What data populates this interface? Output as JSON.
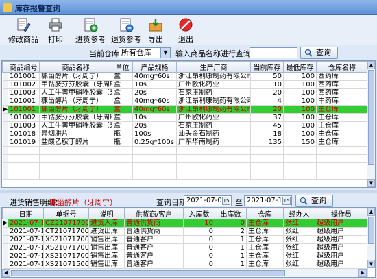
{
  "window": {
    "title": "库存报警查询"
  },
  "toolbar": {
    "buttons": [
      {
        "label": "修改商品",
        "icon": "edit-product-icon"
      },
      {
        "label": "打印",
        "icon": "printer-icon"
      },
      {
        "label": "进货参考",
        "icon": "purchase-reference-icon"
      },
      {
        "label": "退货参考",
        "icon": "return-reference-icon"
      },
      {
        "label": "导出",
        "icon": "export-icon"
      },
      {
        "label": "退出",
        "icon": "exit-icon"
      }
    ]
  },
  "filter": {
    "warehouse_label": "当前仓库：",
    "warehouse_value": "所有仓库",
    "name_label": "输入商品名称进行查询：",
    "name_value": "",
    "query_label": "查询"
  },
  "stock_table": {
    "columns": [
      "商品编号",
      "商品名称",
      "单位",
      "产品规格",
      "生产厂商",
      "当前库存",
      "最低库存",
      "仓库名称"
    ],
    "selected_row": 4,
    "rows": [
      [
        "101001",
        "糠甾醇片（牙周宁）",
        "盒",
        "40mg*60s",
        "浙江昂利康制药有限公司",
        "50",
        "100",
        "西药库"
      ],
      [
        "101002",
        "甲钴胺芬芬胶囊（牙周康）",
        "盒",
        "10s",
        "广州欧化药业",
        "10",
        "100",
        "西药库"
      ],
      [
        "101003",
        "人工牛黄甲硝唑胶囊（牙痛安）",
        "盒",
        "20s",
        "石家庄制药",
        "20",
        "100",
        "西药库"
      ],
      [
        "101001",
        "糠甾醇片（牙周宁）",
        "盒",
        "40mg*60s",
        "浙江昂利康制药有限公司",
        "4",
        "100",
        "中药库"
      ],
      [
        "101001",
        "糠甾醇片（牙周宁）",
        "盒",
        "40mg*60s",
        "浙江昂利康制药有限公司",
        "20",
        "100",
        "主仓库"
      ],
      [
        "101002",
        "甲钴胺芬芬胶囊（牙周康）",
        "盒",
        "10s",
        "广州欧化药业",
        "37",
        "100",
        "主仓库"
      ],
      [
        "101003",
        "人工牛黄甲硝唑胶囊（牙痛安）",
        "盒",
        "20s",
        "石家庄制药",
        "45",
        "100",
        "主仓库"
      ],
      [
        "101018",
        "异烟肼片",
        "瓶",
        "100s",
        "汕头金石制药",
        "18",
        "100",
        "主仓库"
      ],
      [
        "101019",
        "盐酸乙胺丁醇片",
        "瓶",
        "0.25g*100s",
        "广东华南制药",
        "135",
        "150",
        "主仓库"
      ]
    ]
  },
  "detail": {
    "label": "进货销售明细：",
    "product_name": "糠甾醇片（牙周宁）",
    "date_label": "查询日期：",
    "date_from": "2021-07-01",
    "date_sep": "至",
    "date_to": "2021-07-17",
    "query_label": "查询"
  },
  "detail_table": {
    "columns": [
      "日期",
      "单据号",
      "说明",
      "供货商/客户",
      "入库数",
      "出库数",
      "仓库",
      "经办人",
      "操作员"
    ],
    "selected_row": 0,
    "rows": [
      [
        "2021-07-17",
        "CZ2107170001",
        "进货入库",
        "普通供货商",
        "10",
        "0",
        "主仓库",
        "张红",
        "超级用户"
      ],
      [
        "2021-07-17",
        "CT2107170001",
        "进货出库",
        "普通供货商",
        "0",
        "2",
        "主仓库",
        "张红",
        "超级用户"
      ],
      [
        "2021-07-17",
        "XS2107170001",
        "销售出库",
        "普通客户",
        "0",
        "1",
        "主仓库",
        "张红",
        "超级用户"
      ],
      [
        "2021-07-17",
        "XS2107170002",
        "销售出库",
        "普通客户",
        "0",
        "1",
        "主仓库",
        "张红",
        "超级用户"
      ],
      [
        "2021-07-17",
        "XS2107170003",
        "销售出库",
        "普通客户",
        "0",
        "1",
        "主仓库",
        "张红",
        "超级用户"
      ],
      [
        "2021-07-15",
        "XS2107150001",
        "销售出库",
        "普通客户",
        "0",
        "1",
        "主仓库",
        "张红",
        "超级用户"
      ],
      [
        "2021-07-15",
        "XS2107150002",
        "销售出库",
        "张先生",
        "0",
        "1",
        "主仓库",
        "张红",
        "超级用户"
      ]
    ]
  },
  "colors": {
    "selected_row_bg": "#33cc33",
    "selected_row_text": "#c00000"
  }
}
